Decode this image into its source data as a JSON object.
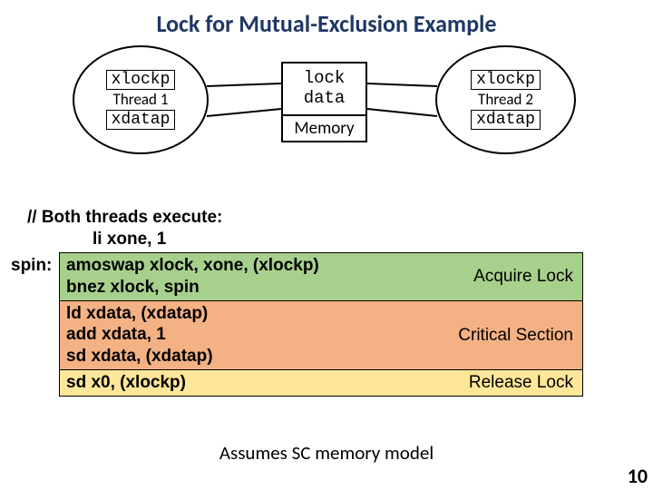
{
  "title": "Lock for Mutual-Exclusion Example",
  "thread1": {
    "xlockp": "xlockp",
    "label": "Thread 1",
    "xdatap": "xdatap"
  },
  "thread2": {
    "xlockp": "xlockp",
    "label": "Thread 2",
    "xdatap": "xdatap"
  },
  "memory": {
    "line1": "lock",
    "line2": "data",
    "label": "Memory"
  },
  "code": {
    "comment": "// Both threads execute:",
    "li": "li xone, 1",
    "spin_prefix": "spin: ",
    "amoswap": "amoswap xlock, xone, (xlockp)",
    "bnez": "bnez xlock, spin",
    "ld": "ld xdata, (xdatap)",
    "add": "add xdata, 1",
    "sd1": "sd xdata, (xdatap)",
    "sd2": "sd x0, (xlockp)"
  },
  "labels": {
    "acquire": "Acquire Lock",
    "critical": "Critical Section",
    "release": "Release Lock"
  },
  "footer": "Assumes SC memory model",
  "page": "10"
}
